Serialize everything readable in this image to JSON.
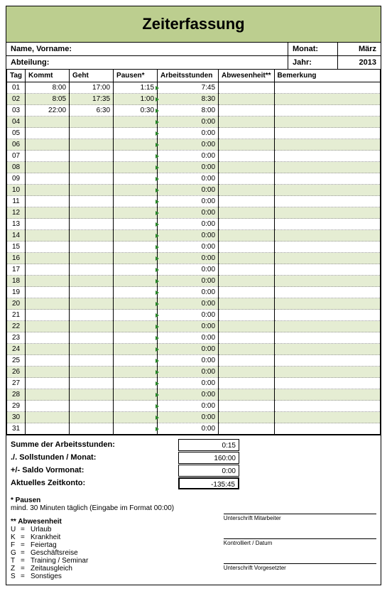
{
  "title": "Zeiterfassung",
  "header": {
    "name_label": "Name, Vorname:",
    "abteilung_label": "Abteilung:",
    "monat_label": "Monat:",
    "monat_value": "März",
    "jahr_label": "Jahr:",
    "jahr_value": "2013"
  },
  "columns": {
    "tag": "Tag",
    "kommt": "Kommt",
    "geht": "Geht",
    "pausen": "Pausen*",
    "arbeitsstunden": "Arbeitsstunden",
    "abwesenheit": "Abwesenheit**",
    "bemerkung": "Bemerkung"
  },
  "rows": [
    {
      "tag": "01",
      "kommt": "8:00",
      "geht": "17:00",
      "pausen": "1:15",
      "arb": "7:45",
      "abw": "",
      "bem": ""
    },
    {
      "tag": "02",
      "kommt": "8:05",
      "geht": "17:35",
      "pausen": "1:00",
      "arb": "8:30",
      "abw": "",
      "bem": ""
    },
    {
      "tag": "03",
      "kommt": "22:00",
      "geht": "6:30",
      "pausen": "0:30",
      "arb": "8:00",
      "abw": "",
      "bem": ""
    },
    {
      "tag": "04",
      "kommt": "",
      "geht": "",
      "pausen": "",
      "arb": "0:00",
      "abw": "",
      "bem": ""
    },
    {
      "tag": "05",
      "kommt": "",
      "geht": "",
      "pausen": "",
      "arb": "0:00",
      "abw": "",
      "bem": ""
    },
    {
      "tag": "06",
      "kommt": "",
      "geht": "",
      "pausen": "",
      "arb": "0:00",
      "abw": "",
      "bem": ""
    },
    {
      "tag": "07",
      "kommt": "",
      "geht": "",
      "pausen": "",
      "arb": "0:00",
      "abw": "",
      "bem": ""
    },
    {
      "tag": "08",
      "kommt": "",
      "geht": "",
      "pausen": "",
      "arb": "0:00",
      "abw": "",
      "bem": ""
    },
    {
      "tag": "09",
      "kommt": "",
      "geht": "",
      "pausen": "",
      "arb": "0:00",
      "abw": "",
      "bem": ""
    },
    {
      "tag": "10",
      "kommt": "",
      "geht": "",
      "pausen": "",
      "arb": "0:00",
      "abw": "",
      "bem": ""
    },
    {
      "tag": "11",
      "kommt": "",
      "geht": "",
      "pausen": "",
      "arb": "0:00",
      "abw": "",
      "bem": ""
    },
    {
      "tag": "12",
      "kommt": "",
      "geht": "",
      "pausen": "",
      "arb": "0:00",
      "abw": "",
      "bem": ""
    },
    {
      "tag": "13",
      "kommt": "",
      "geht": "",
      "pausen": "",
      "arb": "0:00",
      "abw": "",
      "bem": ""
    },
    {
      "tag": "14",
      "kommt": "",
      "geht": "",
      "pausen": "",
      "arb": "0:00",
      "abw": "",
      "bem": ""
    },
    {
      "tag": "15",
      "kommt": "",
      "geht": "",
      "pausen": "",
      "arb": "0:00",
      "abw": "",
      "bem": ""
    },
    {
      "tag": "16",
      "kommt": "",
      "geht": "",
      "pausen": "",
      "arb": "0:00",
      "abw": "",
      "bem": ""
    },
    {
      "tag": "17",
      "kommt": "",
      "geht": "",
      "pausen": "",
      "arb": "0:00",
      "abw": "",
      "bem": ""
    },
    {
      "tag": "18",
      "kommt": "",
      "geht": "",
      "pausen": "",
      "arb": "0:00",
      "abw": "",
      "bem": ""
    },
    {
      "tag": "19",
      "kommt": "",
      "geht": "",
      "pausen": "",
      "arb": "0:00",
      "abw": "",
      "bem": ""
    },
    {
      "tag": "20",
      "kommt": "",
      "geht": "",
      "pausen": "",
      "arb": "0:00",
      "abw": "",
      "bem": ""
    },
    {
      "tag": "21",
      "kommt": "",
      "geht": "",
      "pausen": "",
      "arb": "0:00",
      "abw": "",
      "bem": ""
    },
    {
      "tag": "22",
      "kommt": "",
      "geht": "",
      "pausen": "",
      "arb": "0:00",
      "abw": "",
      "bem": ""
    },
    {
      "tag": "23",
      "kommt": "",
      "geht": "",
      "pausen": "",
      "arb": "0:00",
      "abw": "",
      "bem": ""
    },
    {
      "tag": "24",
      "kommt": "",
      "geht": "",
      "pausen": "",
      "arb": "0:00",
      "abw": "",
      "bem": ""
    },
    {
      "tag": "25",
      "kommt": "",
      "geht": "",
      "pausen": "",
      "arb": "0:00",
      "abw": "",
      "bem": ""
    },
    {
      "tag": "26",
      "kommt": "",
      "geht": "",
      "pausen": "",
      "arb": "0:00",
      "abw": "",
      "bem": ""
    },
    {
      "tag": "27",
      "kommt": "",
      "geht": "",
      "pausen": "",
      "arb": "0:00",
      "abw": "",
      "bem": ""
    },
    {
      "tag": "28",
      "kommt": "",
      "geht": "",
      "pausen": "",
      "arb": "0:00",
      "abw": "",
      "bem": ""
    },
    {
      "tag": "29",
      "kommt": "",
      "geht": "",
      "pausen": "",
      "arb": "0:00",
      "abw": "",
      "bem": ""
    },
    {
      "tag": "30",
      "kommt": "",
      "geht": "",
      "pausen": "",
      "arb": "0:00",
      "abw": "",
      "bem": ""
    },
    {
      "tag": "31",
      "kommt": "",
      "geht": "",
      "pausen": "",
      "arb": "0:00",
      "abw": "",
      "bem": ""
    }
  ],
  "summary": {
    "summe_label": "Summe der Arbeitsstunden:",
    "summe_value": "0:15",
    "soll_label": "./. Sollstunden / Monat:",
    "soll_value": "160:00",
    "saldo_label": "+/- Saldo Vormonat:",
    "saldo_value": "0:00",
    "aktuell_label": "Aktuelles Zeitkonto:",
    "aktuell_value": "-135:45"
  },
  "footer": {
    "pausen_title": "* Pausen",
    "pausen_note": "mind. 30 Minuten täglich (Eingabe im Format 00:00)",
    "abw_title": "** Abwesenheit",
    "legend": [
      {
        "code": "U",
        "text": "Urlaub"
      },
      {
        "code": "K",
        "text": "Krankheit"
      },
      {
        "code": "F",
        "text": "Feiertag"
      },
      {
        "code": "G",
        "text": "Geschäftsreise"
      },
      {
        "code": "T",
        "text": "Training / Seminar"
      },
      {
        "code": "Z",
        "text": "Zeitausgleich"
      },
      {
        "code": "S",
        "text": "Sonstiges"
      }
    ],
    "sig1": "Unterschrift Mitarbeiter",
    "sig2": "Kontrolliert / Datum",
    "sig3": "Unterschrift Vorgesetzter"
  }
}
